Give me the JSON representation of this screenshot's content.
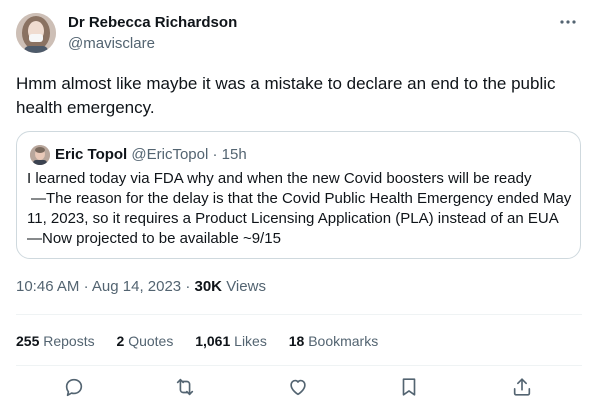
{
  "author": {
    "name": "Dr Rebecca Richardson",
    "handle": "@mavisclare",
    "avatar_icon": "profile-photo"
  },
  "more_icon": "ellipsis-icon",
  "post": {
    "text": "Hmm almost like maybe it was a mistake to declare an end to the public health emergency."
  },
  "quoted": {
    "name": "Eric Topol",
    "handle": "@EricTopol",
    "separator": "·",
    "time": "15h",
    "lines": [
      "I learned today via FDA why and when the new Covid boosters will be ready",
      "—The reason for the delay is that the Covid Public Health Emergency ended May",
      "11, 2023, so it requires a Product Licensing Application (PLA) instead of an EUA",
      "—Now projected to be available ~9/15"
    ]
  },
  "meta": {
    "time": "10:46 AM",
    "dot": "·",
    "date": "Aug 14, 2023",
    "views_count": "30K",
    "views_label": "Views"
  },
  "stats": {
    "reposts_count": "255",
    "reposts_label": "Reposts",
    "quotes_count": "2",
    "quotes_label": "Quotes",
    "likes_count": "1,061",
    "likes_label": "Likes",
    "bookmarks_count": "18",
    "bookmarks_label": "Bookmarks"
  },
  "actions": [
    "reply-icon",
    "repost-icon",
    "like-icon",
    "bookmark-icon",
    "share-icon"
  ],
  "colors": {
    "text": "#0f1419",
    "secondary": "#536471",
    "border": "#cfd9de",
    "divider": "#eff3f4"
  }
}
